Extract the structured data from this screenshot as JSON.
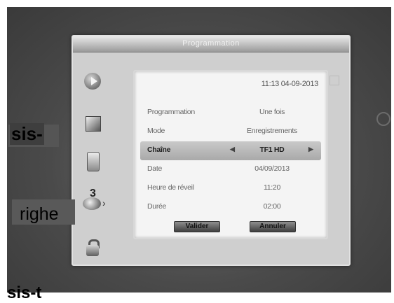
{
  "header": {
    "title": "Programmation"
  },
  "datetime": "11:13 04-09-2013",
  "rows": [
    {
      "label": "Programmation",
      "value": "Une fois"
    },
    {
      "label": "Mode",
      "value": "Enregistrements"
    },
    {
      "label": "Chaîne",
      "value": "TF1 HD",
      "selected": true
    },
    {
      "label": "Date",
      "value": "04/09/2013"
    },
    {
      "label": "Heure de réveil",
      "value": "11:20"
    },
    {
      "label": "Durée",
      "value": "02:00"
    }
  ],
  "buttons": {
    "validate": "Valider",
    "cancel": "Annuler"
  },
  "timer_icon_number": "3",
  "overlays": {
    "left_top": "sis-",
    "left_mid": "righe",
    "bottom": "sis-t"
  },
  "icons": [
    "play-disc-icon",
    "tv-icon",
    "media-card-icon",
    "timer-icon",
    "lock-icon"
  ]
}
